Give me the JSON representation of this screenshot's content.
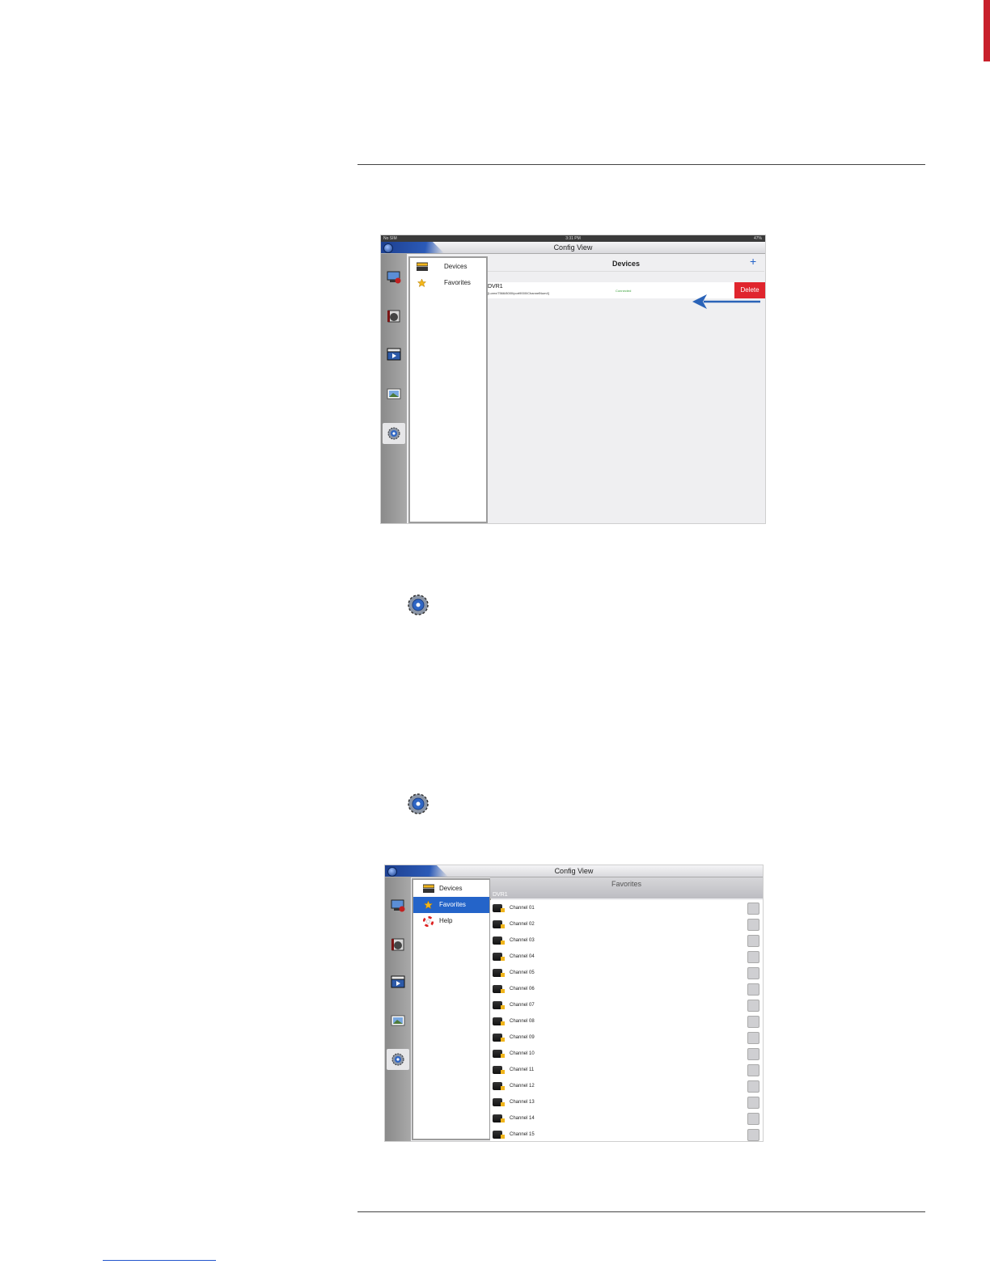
{
  "screenshot1": {
    "status_left": "No SIM",
    "status_time": "3:31 PM",
    "status_right": "47%",
    "title": "Config View",
    "menu": [
      {
        "label": "Devices",
        "icon": "dvr-icon"
      },
      {
        "label": "Favorites",
        "icon": "star-icon"
      }
    ],
    "content_title": "Devices",
    "add_symbol": "+",
    "device": {
      "name": "DVR1",
      "detail": "[Lorex/7566/8000/port9000/ChannelNum4]",
      "status": "Connected"
    },
    "delete_label": "Delete"
  },
  "screenshot2": {
    "title": "Config View",
    "menu": [
      {
        "label": "Devices"
      },
      {
        "label": "Favorites"
      },
      {
        "label": "Help"
      }
    ],
    "content_title": "Favorites",
    "group_label": "DVR1",
    "channels": [
      "Channel 01",
      "Channel 02",
      "Channel 03",
      "Channel 04",
      "Channel 05",
      "Channel 06",
      "Channel 07",
      "Channel 08",
      "Channel 09",
      "Channel 10",
      "Channel 11",
      "Channel 12",
      "Channel 13",
      "Channel 14",
      "Channel 15"
    ]
  },
  "colors": {
    "accent_blue": "#2464c9",
    "delete_red": "#e0252d",
    "connected_green": "#3da23d",
    "arrow_blue": "#2a63b8"
  }
}
